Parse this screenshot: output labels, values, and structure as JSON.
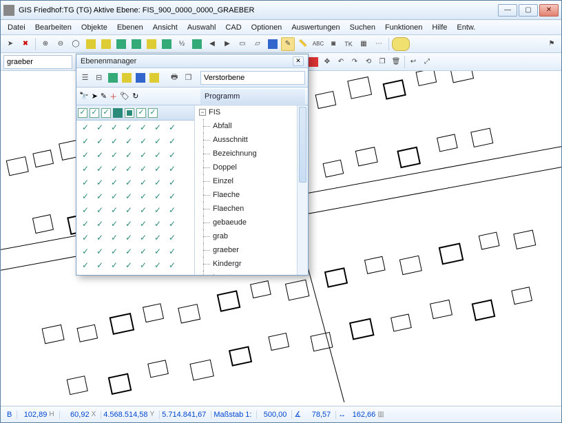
{
  "window": {
    "title": "GIS Friedhof:TG (TG) Aktive Ebene: FIS_900_0000_0000_GRAEBER"
  },
  "menu": [
    "Datei",
    "Bearbeiten",
    "Objekte",
    "Ebenen",
    "Ansicht",
    "Auswahl",
    "CAD",
    "Optionen",
    "Auswertungen",
    "Suchen",
    "Funktionen",
    "Hilfe",
    "Entw."
  ],
  "toolbar1_labels": {
    "TK": "TK",
    "half": "½",
    "abc": "ABC"
  },
  "search_value": "graeber",
  "dialog": {
    "title": "Ebenenmanager",
    "prog_header": "Programm",
    "filter_value": "Verstorbene",
    "tree_root": "FIS",
    "tree_items": [
      "Abfall",
      "Ausschnitt",
      "Bezeichnung",
      "Doppel",
      "Einzel",
      "Flaeche",
      "Flaechen",
      "gebaeude",
      "grab",
      "graeber",
      "Kindergr",
      "Legate"
    ]
  },
  "status": {
    "B_label": "B",
    "B_val": "102,89",
    "H_label": "H",
    "H_val": "60,92",
    "X_label": "X",
    "X_val": "4.568.514,58",
    "Y_label": "Y",
    "Y_val": "5.714.841,67",
    "scale_label": "Maßstab 1:",
    "scale_val": "500,00",
    "ang_val": "78,57",
    "len_val": "162,66"
  }
}
